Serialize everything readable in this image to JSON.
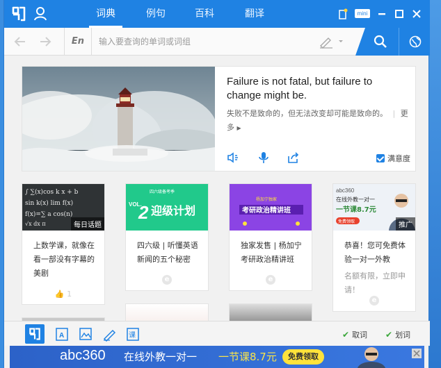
{
  "header": {
    "tabs": [
      {
        "label": "词典",
        "active": true
      },
      {
        "label": "例句",
        "active": false
      },
      {
        "label": "百科",
        "active": false
      },
      {
        "label": "翻译",
        "active": false
      }
    ],
    "mini_label": "mini"
  },
  "search": {
    "lang_label": "En",
    "placeholder": "输入要查询的单词或词组"
  },
  "daily": {
    "quote_en": "Failure is not fatal, but failure to change might be.",
    "quote_cn": "失败不是致命的，但无法改变却可能是致命的。",
    "more_label": "更多",
    "satisfaction_label": "满意度"
  },
  "cards": [
    {
      "tag": "每日话题",
      "title": "上数学课，就像在看一部没有字幕的美剧",
      "likes": "1"
    },
    {
      "tag": "",
      "title": "四六级 | 听懂英语新闻的五个秘密",
      "likes": ""
    },
    {
      "tag": "",
      "title": "独家发售 | 杨加宁考研政治精讲班",
      "likes": ""
    },
    {
      "tag": "推广",
      "title": "恭喜！您可免费体验一对一外教",
      "subtitle": "名额有限，立即申请！",
      "likes": ""
    }
  ],
  "card_images": {
    "card2_text": "迎级计划",
    "card2_small": "四六级备考季",
    "card2_vol": "VOL.",
    "card3_text": "考研政治精讲班",
    "card3_small": "杨加宁独家",
    "card4_brand": "abc360",
    "card4_line1": "在线外教一对一",
    "card4_line2": "一节课8.7元",
    "card4_btn": "免费领取"
  },
  "toolbar": {
    "copy_toggle": "取词",
    "select_toggle": "划词"
  },
  "ad": {
    "brand": "abc360",
    "text": "在线外教一对一",
    "price": "一节课8.7元",
    "cta": "免费领取"
  },
  "colors": {
    "accent": "#1f82e3",
    "checkmark": "#3aa63a",
    "ad_yellow": "#ffe23b"
  }
}
